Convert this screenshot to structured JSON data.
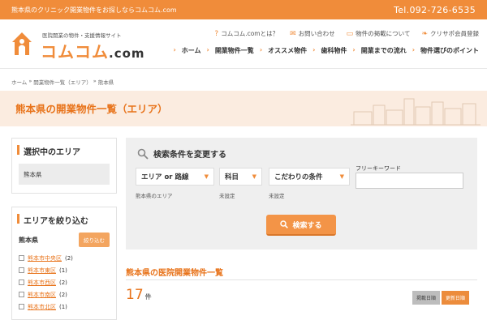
{
  "topbar": {
    "tagline": "熊本県のクリニック開業物件をお探しならコムコム.com",
    "tel": "Tel.092-726-6535"
  },
  "logo": {
    "tagline": "医院開業の物件・支援情報サイト",
    "name": "コムコム",
    "suffix": ".com"
  },
  "utility": [
    {
      "icon": "question-icon",
      "label": "コムコム.comとは？"
    },
    {
      "icon": "mail-icon",
      "label": "お問い合わせ"
    },
    {
      "icon": "monitor-icon",
      "label": "物件の掲載について"
    },
    {
      "icon": "leaf-icon",
      "label": "クリサポ会員登録"
    }
  ],
  "gnav": [
    "ホーム",
    "開業物件一覧",
    "オススメ物件",
    "歯科物件",
    "開業までの流れ",
    "物件選びのポイント"
  ],
  "breadcrumb": [
    "ホーム",
    "»",
    "開業物件一覧（エリア）",
    "»",
    "熊本県"
  ],
  "page_title": "熊本県の開業物件一覧（エリア）",
  "sidebar": {
    "selected_heading": "選択中のエリア",
    "selected_value": "熊本県",
    "narrow_heading": "エリアを絞り込む",
    "pref": "熊本県",
    "narrow_button": "絞り込む",
    "cities": [
      {
        "name": "熊本市中央区",
        "count": "(2)"
      },
      {
        "name": "熊本市東区",
        "count": "(1)"
      },
      {
        "name": "熊本市西区",
        "count": "(2)"
      },
      {
        "name": "熊本市南区",
        "count": "(2)"
      },
      {
        "name": "熊本市北区",
        "count": "(1)"
      }
    ]
  },
  "search": {
    "title": "検索条件を変更する",
    "area_select": "エリア or 路線",
    "area_sub": "熊本県のエリア",
    "dept_select": "科目",
    "dept_sub": "未設定",
    "cond_select": "こだわりの条件",
    "cond_sub": "未設定",
    "keyword_label": "フリーキーワード",
    "keyword_value": "",
    "button": "検索する"
  },
  "list": {
    "title": "熊本県の医院開業物件一覧",
    "count": "17",
    "count_unit": "件",
    "sort_a": "掲載日順",
    "sort_b": "更新日順"
  }
}
